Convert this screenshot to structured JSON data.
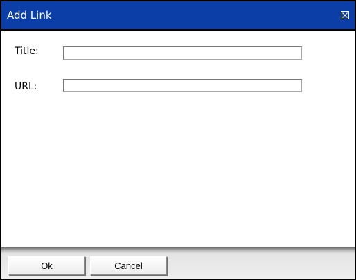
{
  "dialog": {
    "title": "Add Link",
    "close_icon": "close-box-icon"
  },
  "form": {
    "title_label": "Title:",
    "title_value": "",
    "url_label": "URL:",
    "url_value": ""
  },
  "footer": {
    "ok_label": "Ok",
    "cancel_label": "Cancel"
  },
  "colors": {
    "titlebar": "#0c3ea8",
    "title_text": "#ffffff"
  }
}
